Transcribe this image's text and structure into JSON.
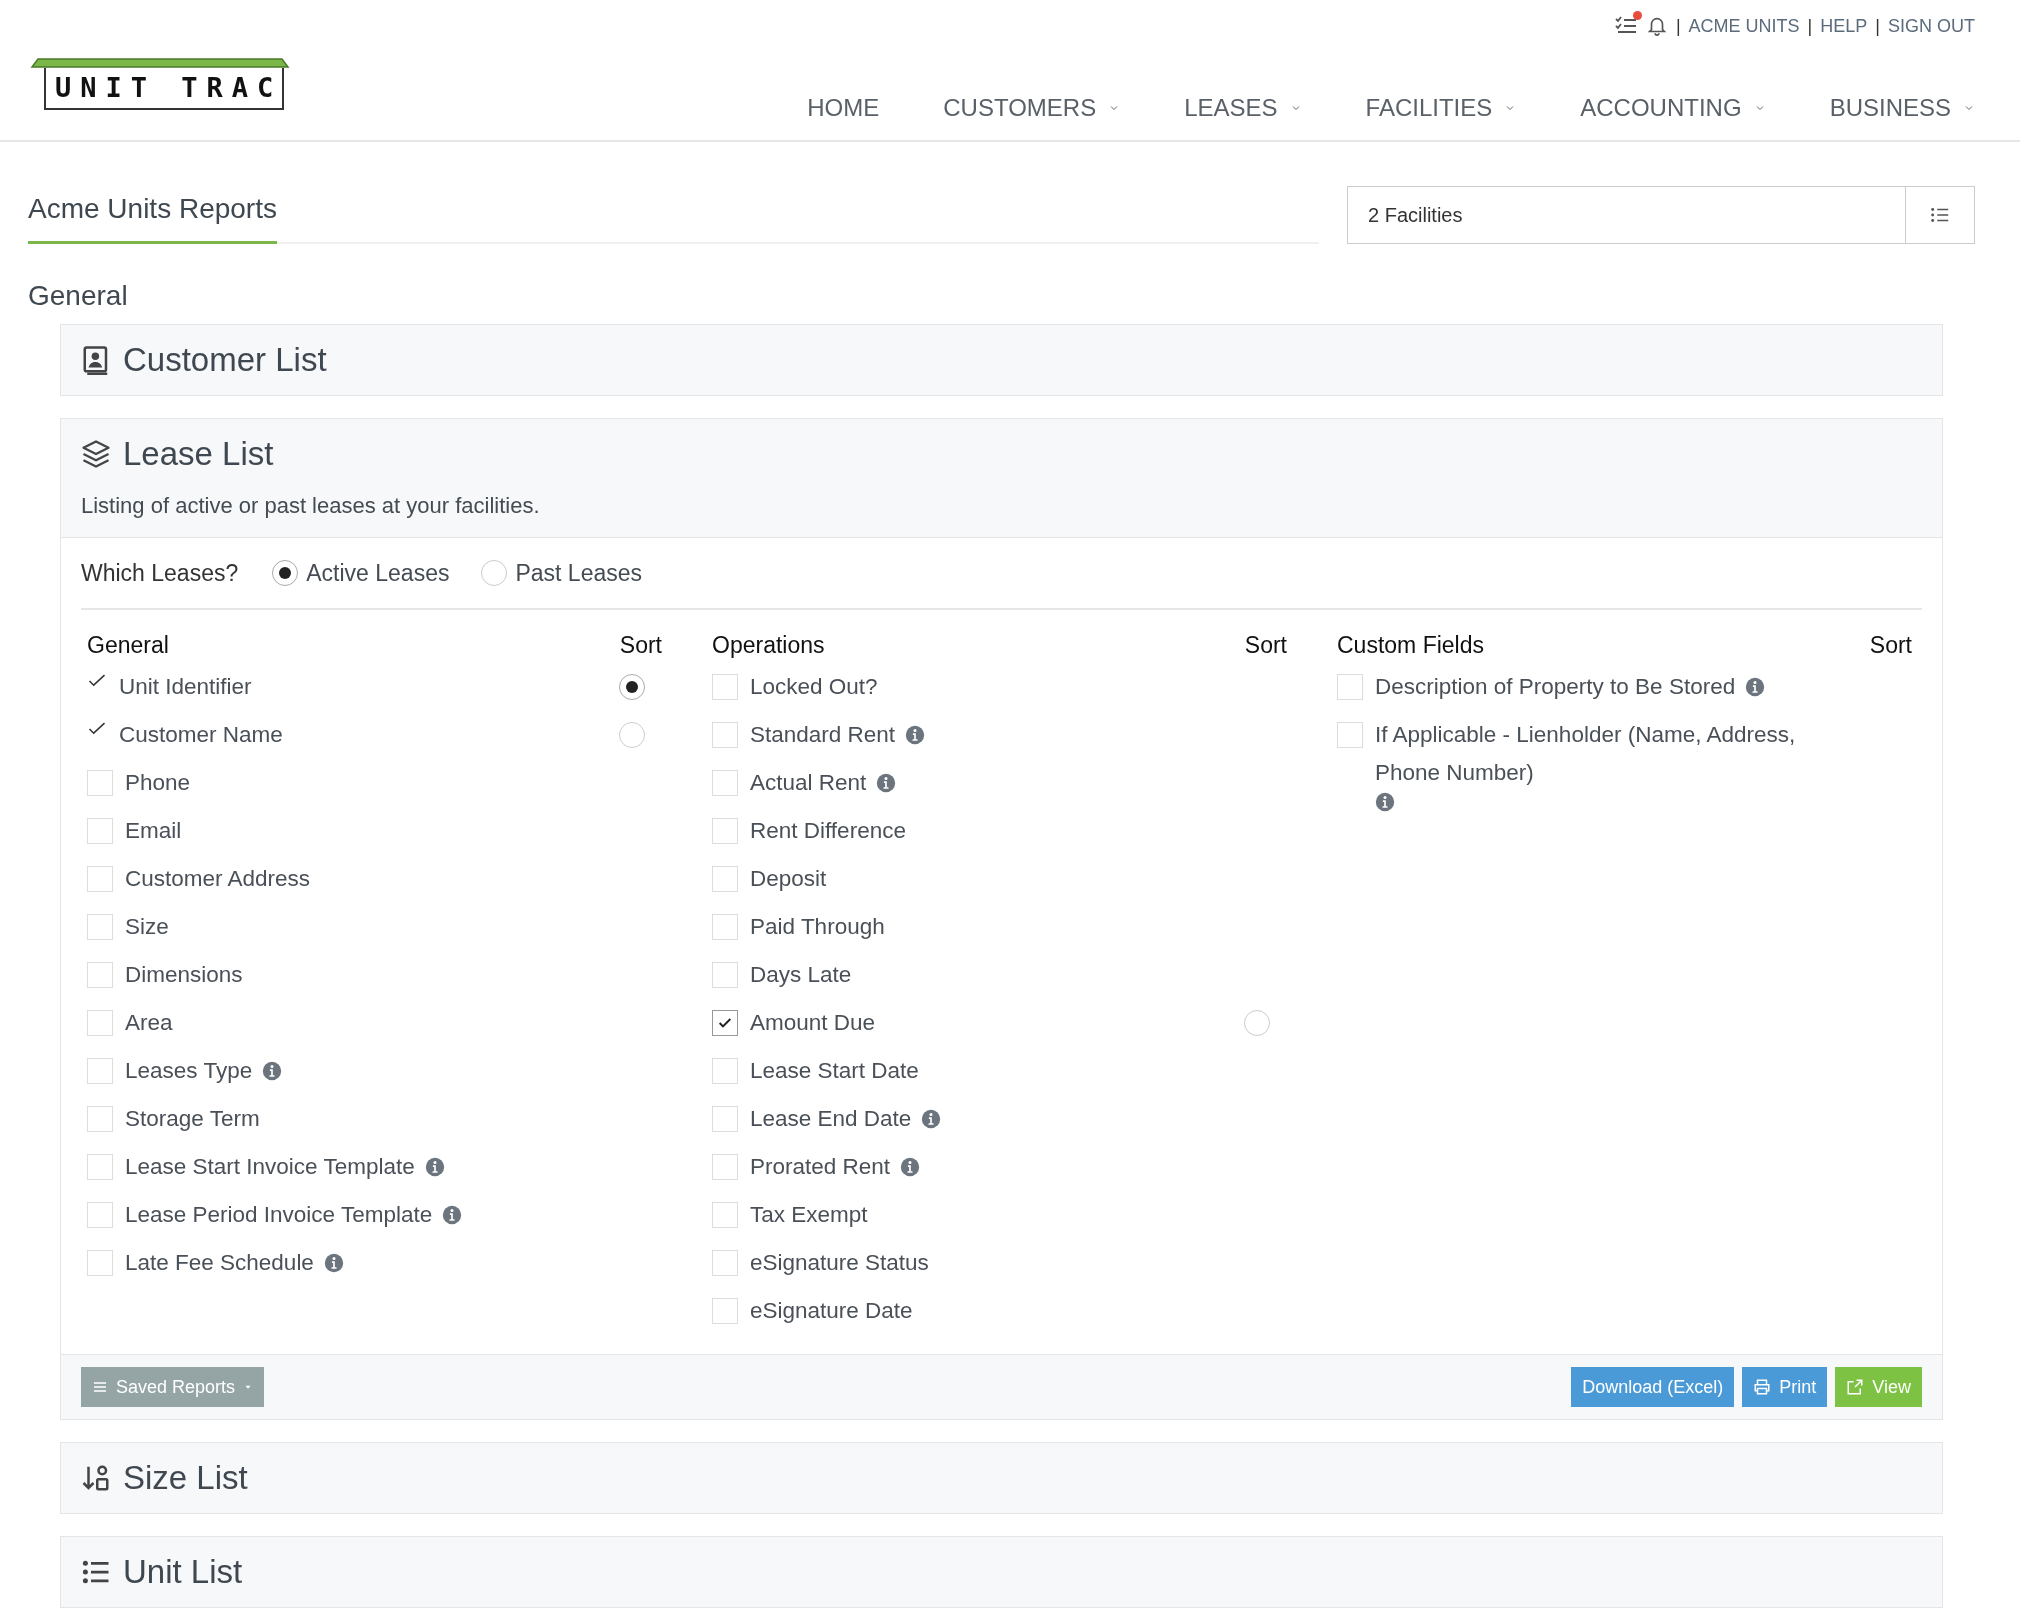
{
  "header": {
    "logo": "UNIT TRAC",
    "notification_dot": true,
    "links": [
      {
        "separator": "|",
        "label": "ACME UNITS"
      },
      {
        "separator": "|",
        "label": "HELP"
      },
      {
        "separator": "|",
        "label": "SIGN OUT"
      }
    ],
    "nav": [
      {
        "label": "HOME",
        "dropdown": false
      },
      {
        "label": "CUSTOMERS",
        "dropdown": true
      },
      {
        "label": "LEASES",
        "dropdown": true
      },
      {
        "label": "FACILITIES",
        "dropdown": true
      },
      {
        "label": "ACCOUNTING",
        "dropdown": true
      },
      {
        "label": "BUSINESS",
        "dropdown": true
      }
    ]
  },
  "page_title": "Acme Units Reports",
  "facilities_select": {
    "value": "2 Facilities"
  },
  "group_title": "General",
  "reports": [
    {
      "title": "Customer List",
      "expanded": false
    },
    {
      "title": "Lease List",
      "expanded": true,
      "description": "Listing of active or past leases at your facilities.",
      "which": {
        "label": "Which Leases?",
        "options": [
          {
            "label": "Active Leases",
            "selected": true
          },
          {
            "label": "Past Leases",
            "selected": false
          }
        ]
      },
      "columns": [
        {
          "title": "General",
          "sort_label": "Sort",
          "items": [
            {
              "label": "Unit Identifier",
              "kind": "fixed",
              "sort": {
                "selected": true
              }
            },
            {
              "label": "Customer Name",
              "kind": "fixed",
              "sort": {
                "selected": false
              }
            },
            {
              "label": "Phone",
              "kind": "checkbox",
              "checked": false
            },
            {
              "label": "Email",
              "kind": "checkbox",
              "checked": false
            },
            {
              "label": "Customer Address",
              "kind": "checkbox",
              "checked": false
            },
            {
              "label": "Size",
              "kind": "checkbox",
              "checked": false
            },
            {
              "label": "Dimensions",
              "kind": "checkbox",
              "checked": false
            },
            {
              "label": "Area",
              "kind": "checkbox",
              "checked": false
            },
            {
              "label": "Leases Type",
              "kind": "checkbox",
              "checked": false,
              "info": true
            },
            {
              "label": "Storage Term",
              "kind": "checkbox",
              "checked": false
            },
            {
              "label": "Lease Start Invoice Template",
              "kind": "checkbox",
              "checked": false,
              "info": true
            },
            {
              "label": "Lease Period Invoice Template",
              "kind": "checkbox",
              "checked": false,
              "info": true
            },
            {
              "label": "Late Fee Schedule",
              "kind": "checkbox",
              "checked": false,
              "info": true
            }
          ]
        },
        {
          "title": "Operations",
          "sort_label": "Sort",
          "items": [
            {
              "label": "Locked Out?",
              "kind": "checkbox",
              "checked": false
            },
            {
              "label": "Standard Rent",
              "kind": "checkbox",
              "checked": false,
              "info": true
            },
            {
              "label": "Actual Rent",
              "kind": "checkbox",
              "checked": false,
              "info": true
            },
            {
              "label": "Rent Difference",
              "kind": "checkbox",
              "checked": false
            },
            {
              "label": "Deposit",
              "kind": "checkbox",
              "checked": false
            },
            {
              "label": "Paid Through",
              "kind": "checkbox",
              "checked": false
            },
            {
              "label": "Days Late",
              "kind": "checkbox",
              "checked": false
            },
            {
              "label": "Amount Due",
              "kind": "checkbox",
              "checked": true,
              "sort": {
                "selected": false
              }
            },
            {
              "label": "Lease Start Date",
              "kind": "checkbox",
              "checked": false
            },
            {
              "label": "Lease End Date",
              "kind": "checkbox",
              "checked": false,
              "info": true
            },
            {
              "label": "Prorated Rent",
              "kind": "checkbox",
              "checked": false,
              "info": true
            },
            {
              "label": "Tax Exempt",
              "kind": "checkbox",
              "checked": false
            },
            {
              "label": "eSignature Status",
              "kind": "checkbox",
              "checked": false
            },
            {
              "label": "eSignature Date",
              "kind": "checkbox",
              "checked": false
            }
          ]
        },
        {
          "title": "Custom Fields",
          "sort_label": "Sort",
          "items": [
            {
              "label": "Description of Property to Be Stored",
              "kind": "checkbox",
              "checked": false,
              "info": true
            },
            {
              "label": "If Applicable - Lienholder (Name, Address, Phone Number)",
              "kind": "checkbox",
              "checked": false,
              "info": true
            }
          ]
        }
      ],
      "saved_reports": "Saved Reports",
      "actions": [
        {
          "label": "Download (Excel)",
          "kind": "download"
        },
        {
          "label": "Print",
          "kind": "print"
        },
        {
          "label": "View",
          "kind": "view"
        }
      ]
    },
    {
      "title": "Size List",
      "expanded": false
    },
    {
      "title": "Unit List",
      "expanded": false
    }
  ]
}
